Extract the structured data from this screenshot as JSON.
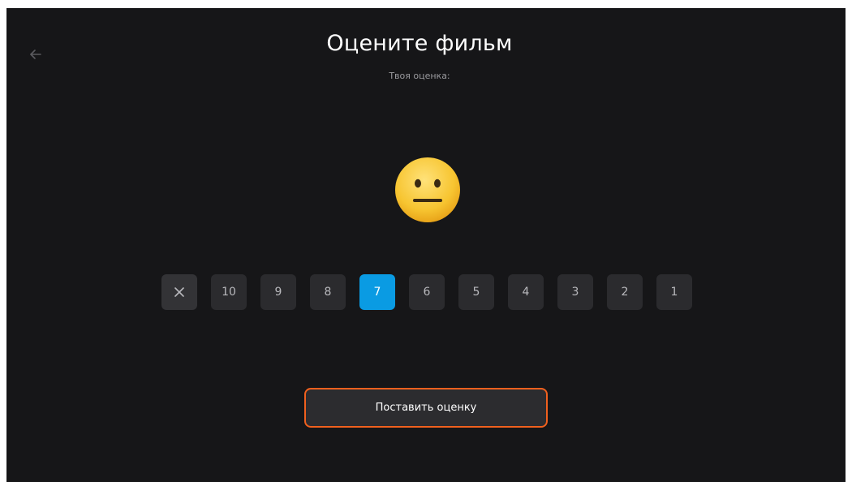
{
  "header": {
    "title": "Оцените фильм",
    "subtitle": "Твоя оценка:",
    "back_icon": "arrow-left-icon"
  },
  "emoji": {
    "icon": "neutral-face-icon"
  },
  "rating": {
    "options": [
      "10",
      "9",
      "8",
      "7",
      "6",
      "5",
      "4",
      "3",
      "2",
      "1"
    ],
    "clear_icon": "close-icon",
    "selected": "7"
  },
  "submit": {
    "label": "Поставить оценку"
  },
  "colors": {
    "background": "#161618",
    "button_bg": "#2b2b2e",
    "selected_accent": "#0a9be3",
    "focus_outline": "#f0601e"
  }
}
